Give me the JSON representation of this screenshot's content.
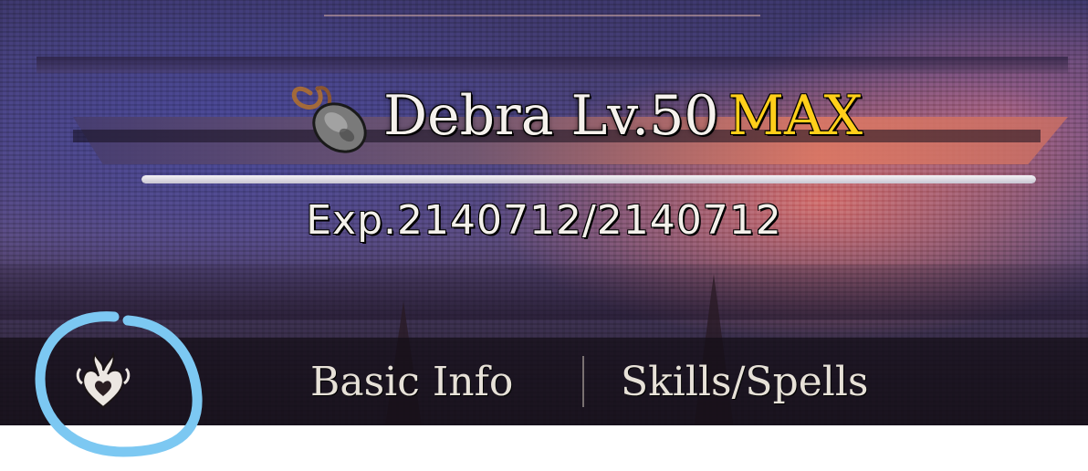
{
  "header": {
    "item_icon": "stone-pendant-icon",
    "name": "Debra Lv.50",
    "max_label": "MAX",
    "max_color": "#ffcf1a"
  },
  "experience": {
    "text": "Exp.2140712/2140712",
    "current": 2140712,
    "total": 2140712,
    "fill_fraction": 1.0
  },
  "tabs": {
    "emblem_icon": "flame-heart-emblem-icon",
    "items": [
      {
        "label": "Basic Info"
      },
      {
        "label": "Skills/Spells"
      }
    ]
  },
  "annotation": {
    "circle_color": "#7cc8f2"
  }
}
